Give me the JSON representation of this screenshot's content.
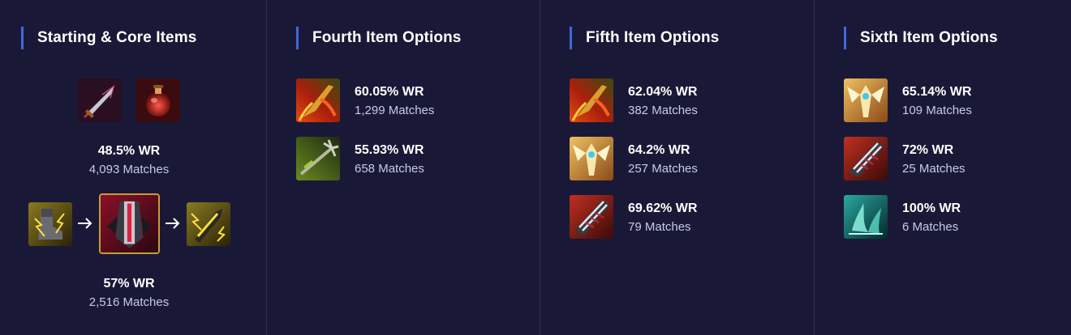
{
  "columns": [
    {
      "title": "Starting & Core Items",
      "starting": {
        "items": [
          "sword-icon",
          "potion-icon"
        ],
        "win_rate": "48.5% WR",
        "matches": "4,093 Matches"
      },
      "core": {
        "items": [
          "boots-icon",
          "armor-icon",
          "blade-icon"
        ],
        "win_rate": "57% WR",
        "matches": "2,516 Matches"
      }
    },
    {
      "title": "Fourth Item Options",
      "options": [
        {
          "icon": "flame-blade-icon",
          "win_rate": "60.05% WR",
          "matches": "1,299 Matches"
        },
        {
          "icon": "trident-icon",
          "win_rate": "55.93% WR",
          "matches": "658 Matches"
        }
      ]
    },
    {
      "title": "Fifth Item Options",
      "options": [
        {
          "icon": "flame-blade-icon",
          "win_rate": "62.04% WR",
          "matches": "382 Matches"
        },
        {
          "icon": "angel-icon",
          "win_rate": "64.2% WR",
          "matches": "257 Matches"
        },
        {
          "icon": "red-blade-icon",
          "win_rate": "69.62% WR",
          "matches": "79 Matches"
        }
      ]
    },
    {
      "title": "Sixth Item Options",
      "options": [
        {
          "icon": "angel-icon",
          "win_rate": "65.14% WR",
          "matches": "109 Matches"
        },
        {
          "icon": "red-blade-icon",
          "win_rate": "72% WR",
          "matches": "25 Matches"
        },
        {
          "icon": "teal-spirit-icon",
          "win_rate": "100% WR",
          "matches": "6 Matches"
        }
      ]
    }
  ],
  "colors": {
    "background": "#191937",
    "accent": "#3e6bd6",
    "divider": "#2e2e52",
    "muted_text": "#c6cbe3",
    "core_frame": "#c89b3c"
  }
}
